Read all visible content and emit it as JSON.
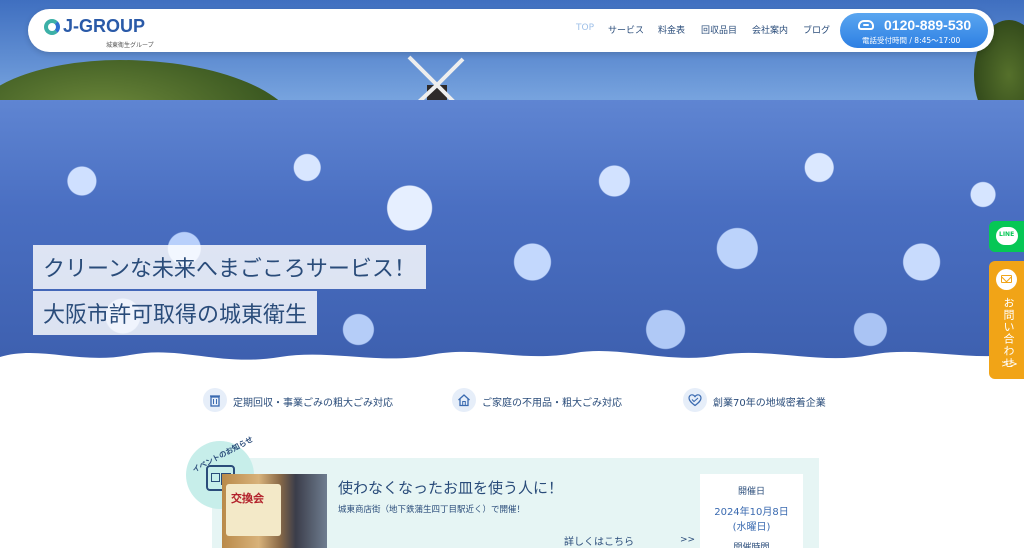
{
  "brand": {
    "logo_text": "J-GROUP",
    "logo_sub": "城東衛生グループ"
  },
  "nav": {
    "items": [
      {
        "label": "TOP"
      },
      {
        "label": "サービス"
      },
      {
        "label": "料金表"
      },
      {
        "label": "回収品目"
      },
      {
        "label": "会社案内"
      },
      {
        "label": "ブログ"
      }
    ],
    "active": "TOP"
  },
  "phone": {
    "number": "0120-889-530",
    "hours": "電話受付時間 / 8:45〜17:00"
  },
  "hero": {
    "catch_line1": "クリーンな未来へまごころサービス！",
    "catch_line2": "大阪市許可取得の城東衛生"
  },
  "side": {
    "line_label": "LINE",
    "contact_label": "お問い合わせ",
    "contact_arrow": ">>"
  },
  "features": [
    {
      "icon": "trash-can-icon",
      "text": "定期回収・事業ごみの粗大ごみ対応"
    },
    {
      "icon": "house-icon",
      "text": "ご家庭の不用品・粗大ごみ対応"
    },
    {
      "icon": "heart-handshake-icon",
      "text": "創業70年の地域密着企業"
    }
  ],
  "event": {
    "badge": "イベントのお知らせ",
    "photo_text": "交換会",
    "title": "使わなくなったお皿を使う人に！",
    "description": "城東商店街（地下鉄蒲生四丁目駅近く）で開催！",
    "more_label": "詳しくはこちら",
    "more_arrow": ">>",
    "date_label": "開催日",
    "date_value": "2024年10月8日",
    "date_weekday": "(水曜日)",
    "time_label": "開催時間"
  },
  "colors": {
    "brand_blue": "#2a5aa8",
    "accent_teal": "#3cb0a7",
    "text_navy": "#2a4c7a",
    "phone_button": "#2d7fe3",
    "line_green": "#06c755",
    "contact_orange": "#f1a417",
    "event_bg": "#e6f5f4"
  }
}
